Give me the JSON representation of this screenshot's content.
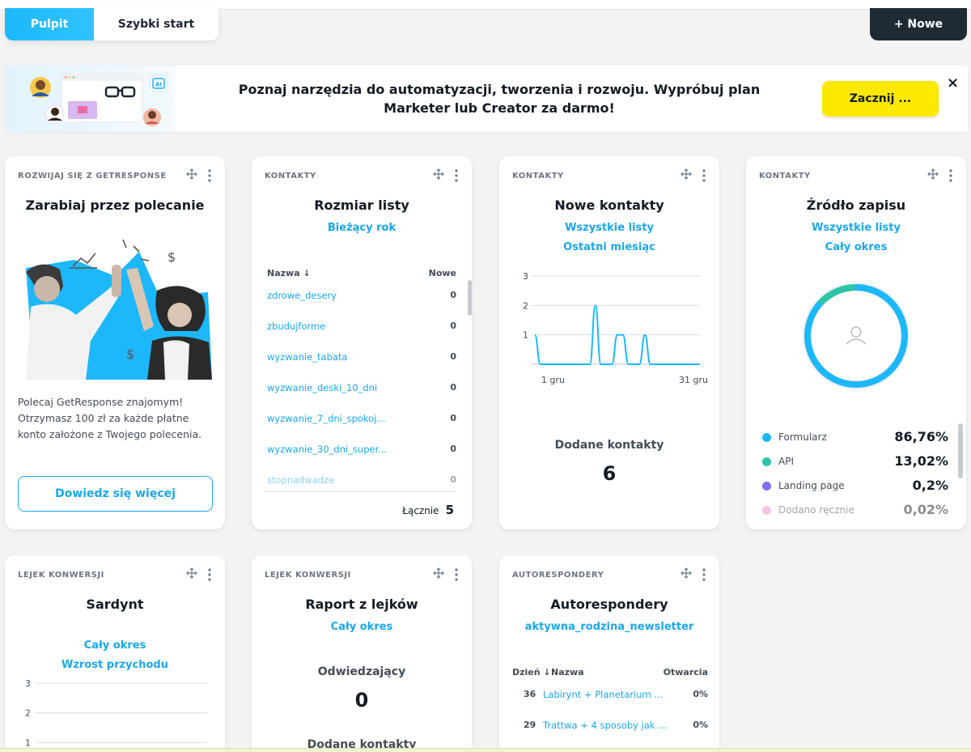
{
  "tabs": {
    "active": "Pulpit",
    "other": "Szybki start"
  },
  "new_button": "+ Nowe",
  "banner": {
    "text": "Poznaj narzędzia do automatyzacji, tworzenia i rozwoju. Wypróbuj plan Marketer lub Creator za darmo!",
    "cta": "Zacznij ...",
    "close": "×",
    "art_badge": "AI"
  },
  "referral": {
    "category": "ROZWIJAJ SIĘ Z GETRESPONSE",
    "title": "Zarabiaj przez polecanie",
    "description": "Polecaj GetResponse znajomym! Otrzymasz 100 zł za każde płatne konto założone z Twojego polecenia.",
    "button": "Dowiedz się więcej"
  },
  "list_size": {
    "category": "KONTAKTY",
    "title": "Rozmiar listy",
    "period": "Bieżący rok",
    "col_name": "Nazwa ↓",
    "col_new": "Nowe",
    "rows": [
      {
        "name": "zdrowe_desery",
        "value": "0"
      },
      {
        "name": "zbudujforme",
        "value": "0"
      },
      {
        "name": "wyzwanie_tabata",
        "value": "0"
      },
      {
        "name": "wyzwanie_deski_10_dni",
        "value": "0"
      },
      {
        "name": "wyzwanie_7_dni_spokoj...",
        "value": "0"
      },
      {
        "name": "wyzwanie_30_dni_super...",
        "value": "0"
      },
      {
        "name": "stopnadwadze",
        "value": "0"
      }
    ],
    "total_label": "Łącznie",
    "total_value": "5"
  },
  "new_contacts": {
    "category": "KONTAKTY",
    "title": "Nowe kontakty",
    "filter1": "Wszystkie listy",
    "filter2": "Ostatni miesiąc",
    "added_label": "Dodane kontakty",
    "added_value": "6"
  },
  "signup_source": {
    "category": "KONTAKTY",
    "title": "Źródło zapisu",
    "filter1": "Wszystkie listy",
    "filter2": "Cały okres",
    "items": [
      {
        "label": "Formularz",
        "pct": "86,76%",
        "color": "#1cb8fb"
      },
      {
        "label": "API",
        "pct": "13,02%",
        "color": "#2ec4a6"
      },
      {
        "label": "Landing page",
        "pct": "0,2%",
        "color": "#7e6ef5"
      },
      {
        "label": "Dodano ręcznie",
        "pct": "0,02%",
        "color": "#ec8bbf"
      }
    ],
    "shares": [
      86.76,
      13.02,
      0.2,
      0.02
    ]
  },
  "sardynt": {
    "category": "LEJEK KONWERSJI",
    "title": "Sardynt",
    "filter1": "Cały okres",
    "filter2": "Wzrost przychodu"
  },
  "funnel_report": {
    "category": "LEJEK KONWERSJI",
    "title": "Raport z lejków",
    "filter1": "Cały okres",
    "visitors_label": "Odwiedzający",
    "visitors_value": "0",
    "added_label": "Dodane kontakty"
  },
  "autoresponders": {
    "category": "AUTORESPONDERY",
    "title": "Autorespondery",
    "filter": "aktywna_rodzina_newsletter",
    "col_day": "Dzień ↓",
    "col_name": "Nazwa",
    "col_open": "Otwarcia",
    "rows": [
      {
        "day": "36",
        "name": "Labirynt + Planetarium ...",
        "open": "0%"
      },
      {
        "day": "29",
        "name": "Trattwa + 4 sposoby jak ...",
        "open": "0%"
      }
    ]
  },
  "chart_data": [
    {
      "type": "line",
      "x": [
        "1 gru",
        "2 gru",
        "3 gru",
        "4 gru",
        "5 gru",
        "6 gru",
        "7 gru",
        "8 gru",
        "9 gru",
        "10 gru",
        "11 gru",
        "12 gru",
        "13 gru",
        "14 gru",
        "15 gru",
        "16 gru",
        "17 gru",
        "18 gru",
        "19 gru",
        "20 gru",
        "21 gru",
        "22 gru",
        "23 gru",
        "24 gru",
        "25 gru",
        "26 gru",
        "27 gru",
        "28 gru",
        "29 gru",
        "30 gru",
        "31 gru"
      ],
      "x_tick_labels": [
        "1 gru",
        "31 gru"
      ],
      "values": [
        1,
        0,
        0,
        0,
        0,
        0,
        0,
        0,
        0,
        0,
        0,
        2,
        0,
        0,
        0,
        1,
        1,
        0,
        0,
        0,
        1,
        0,
        0,
        0,
        0,
        0,
        0,
        0,
        0,
        0,
        0
      ],
      "ylim": [
        0,
        3
      ],
      "yticks": [
        1,
        2,
        3
      ],
      "color": "#1cb8fb"
    },
    {
      "type": "line",
      "yticks": [
        1,
        2,
        3
      ],
      "ylim": [
        0,
        3
      ],
      "values": []
    }
  ]
}
